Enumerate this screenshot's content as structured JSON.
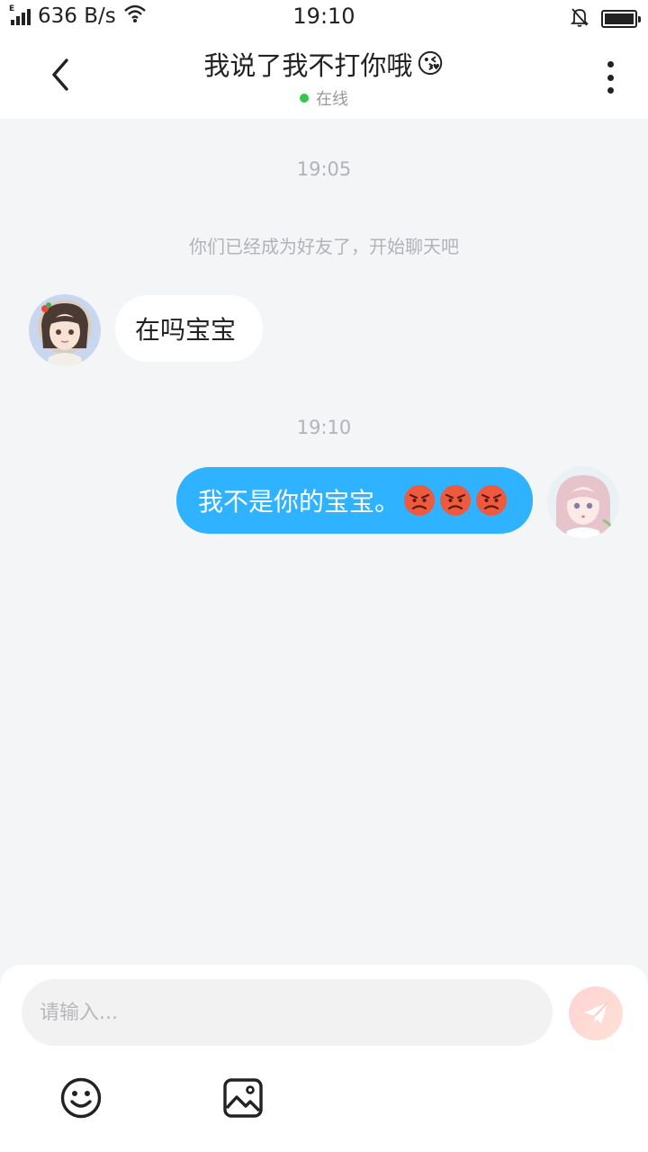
{
  "status_bar": {
    "network_type": "E",
    "speed": "636 B/s",
    "time": "19:10",
    "battery_level": 1.0
  },
  "header": {
    "title": "我说了我不打你哦",
    "title_emoji": "😘",
    "status": "在线",
    "online_color": "#2ec94b"
  },
  "chat": {
    "time_1": "19:05",
    "system_message": "你们已经成为好友了，开始聊天吧",
    "incoming_message": "在吗宝宝",
    "time_2": "19:10",
    "outgoing_message": "我不是你的宝宝。"
  },
  "input": {
    "placeholder": "请输入..."
  },
  "icons": {
    "back": "chevron-left-icon",
    "more": "more-vertical-icon",
    "send": "paper-plane-icon",
    "emoji": "smiley-icon",
    "image": "image-icon",
    "angry": "angry-face-icon"
  },
  "colors": {
    "outgoing_bubble": "#2fb2ff",
    "incoming_bubble": "#ffffff",
    "background": "#f4f5f7"
  }
}
